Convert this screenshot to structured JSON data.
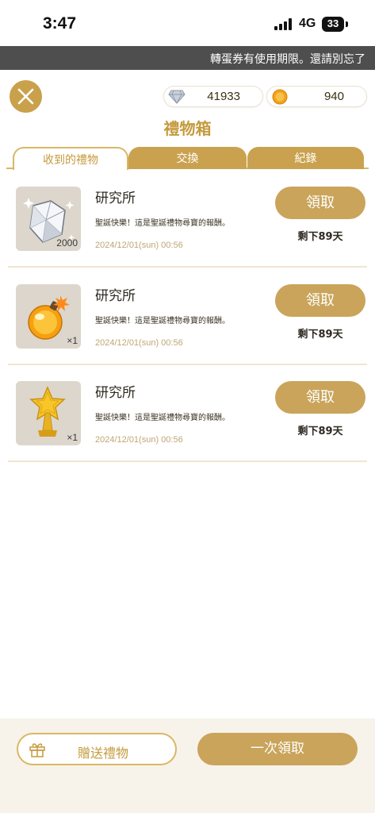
{
  "status_bar": {
    "time": "3:47",
    "network": "4G",
    "battery": "33"
  },
  "ticker": {
    "text": "轉蛋券有使用期限。還請別忘了"
  },
  "currency": {
    "gems": "41933",
    "coins": "940"
  },
  "title": "禮物箱",
  "tabs": [
    {
      "label": "收到的禮物",
      "active": true
    },
    {
      "label": "交換",
      "active": false
    },
    {
      "label": "紀錄",
      "active": false
    }
  ],
  "gifts": [
    {
      "icon": "diamond-icon",
      "quantity": "2000",
      "title": "研究所",
      "description": "聖誕快樂！這是聖誕禮物尋寶的報酬。",
      "date": "2024/12/01(sun) 00:56",
      "claim_label": "領取",
      "remaining": "剩下89天"
    },
    {
      "icon": "bomb-potion-icon",
      "quantity": "×1",
      "title": "研究所",
      "description": "聖誕快樂！這是聖誕禮物尋寶的報酬。",
      "date": "2024/12/01(sun) 00:56",
      "claim_label": "領取",
      "remaining": "剩下89天"
    },
    {
      "icon": "star-trophy-icon",
      "quantity": "×1",
      "title": "研究所",
      "description": "聖誕快樂！這是聖誕禮物尋寶的報酬。",
      "date": "2024/12/01(sun) 00:56",
      "claim_label": "領取",
      "remaining": "剩下89天"
    }
  ],
  "bottom": {
    "send_gift_label": "贈送禮物",
    "claim_all_label": "一次領取"
  },
  "colors": {
    "gold": "#c9a45a",
    "gold_text": "#c59a3d",
    "ticker_bg": "#4e4e4e",
    "bottom_bg": "#f7f3ea"
  }
}
